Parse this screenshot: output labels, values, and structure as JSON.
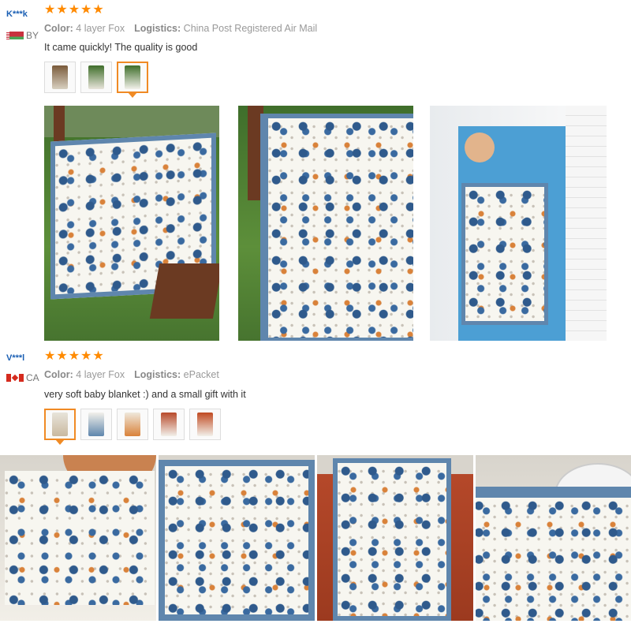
{
  "reviews": [
    {
      "user": "K***k",
      "country": "BY",
      "stars": [
        "★",
        "★",
        "★",
        "★",
        "★"
      ],
      "color_label": "Color:",
      "color_value": "4 layer Fox",
      "logistics_label": "Logistics:",
      "logistics_value": "China Post Registered Air Mail",
      "comment": "It came quickly! The quality is good",
      "thumb_count": 3,
      "active_thumb": 3
    },
    {
      "user": "V***l",
      "country": "CA",
      "stars": [
        "★",
        "★",
        "★",
        "★",
        "★"
      ],
      "color_label": "Color:",
      "color_value": "4 layer Fox",
      "logistics_label": "Logistics:",
      "logistics_value": "ePacket",
      "comment": "very soft baby blanket :) and a small gift with it",
      "thumb_count": 5,
      "active_thumb": 1
    }
  ],
  "colors": {
    "username": "#1a5fb4",
    "star": "#ff8a00",
    "active_thumb_border": "#f08a24",
    "blanket_border": "#5f86ad"
  },
  "icons": [
    "flag-by-icon",
    "flag-ca-icon",
    "star-icon"
  ]
}
